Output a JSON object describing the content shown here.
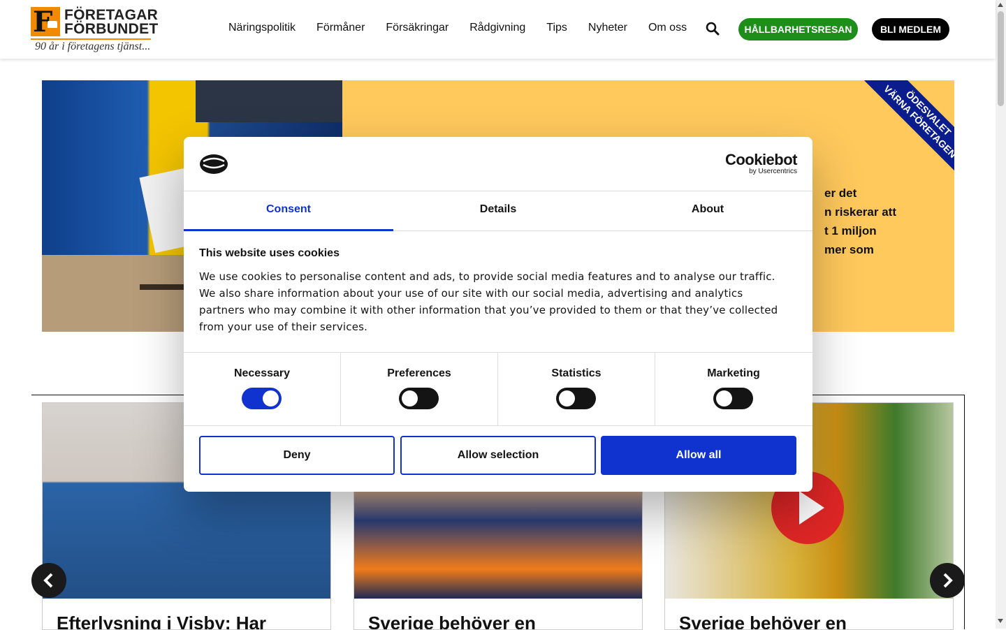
{
  "header": {
    "logo_name": "FÖRETAGAR FÖRBUNDET",
    "logo_line1": "FÖRETAGAR",
    "logo_line2": "FÖRBUNDET",
    "logo_tagline": "90 år i företagens tjänst...",
    "nav": [
      "Näringspolitik",
      "Förmåner",
      "Försäkringar",
      "Rådgivning",
      "Tips",
      "Nyheter",
      "Om oss"
    ],
    "sustainability_button": "HÅLLBARHETSRESAN",
    "member_button": "BLI MEDLEM",
    "brand_color": "#f18a00",
    "green_color": "#1e8e1a"
  },
  "hero": {
    "text_lines": [
      "er det",
      "n riskerar att",
      "t 1 miljon",
      "mer som"
    ],
    "ribbon_line1": "ÖDESVALET",
    "ribbon_line2": "VÄRNA FÖRETAGEN",
    "panel_color": "#ffc95c",
    "ribbon_color": "#0b1c8c"
  },
  "articles": [
    {
      "title": "Efterlysning i Visby: Har"
    },
    {
      "title": "Sverige behöver en"
    },
    {
      "title": "Sverige behöver en"
    }
  ],
  "cookie_dialog": {
    "brand": "Cookiebot",
    "brand_sub": "by Usercentrics",
    "tabs": [
      "Consent",
      "Details",
      "About"
    ],
    "active_tab": "Consent",
    "heading": "This website uses cookies",
    "body": "We use cookies to personalise content and ads, to provide social media features and to analyse our traffic. We also share information about your use of our site with our social media, advertising and analytics partners who may combine it with other information that you’ve provided to them or that they’ve collected from your use of their services.",
    "categories": [
      {
        "label": "Necessary",
        "enabled": true
      },
      {
        "label": "Preferences",
        "enabled": false
      },
      {
        "label": "Statistics",
        "enabled": false
      },
      {
        "label": "Marketing",
        "enabled": false
      }
    ],
    "buttons": {
      "deny": "Deny",
      "allow_selection": "Allow selection",
      "allow_all": "Allow all"
    },
    "accent_color": "#1032cf"
  }
}
